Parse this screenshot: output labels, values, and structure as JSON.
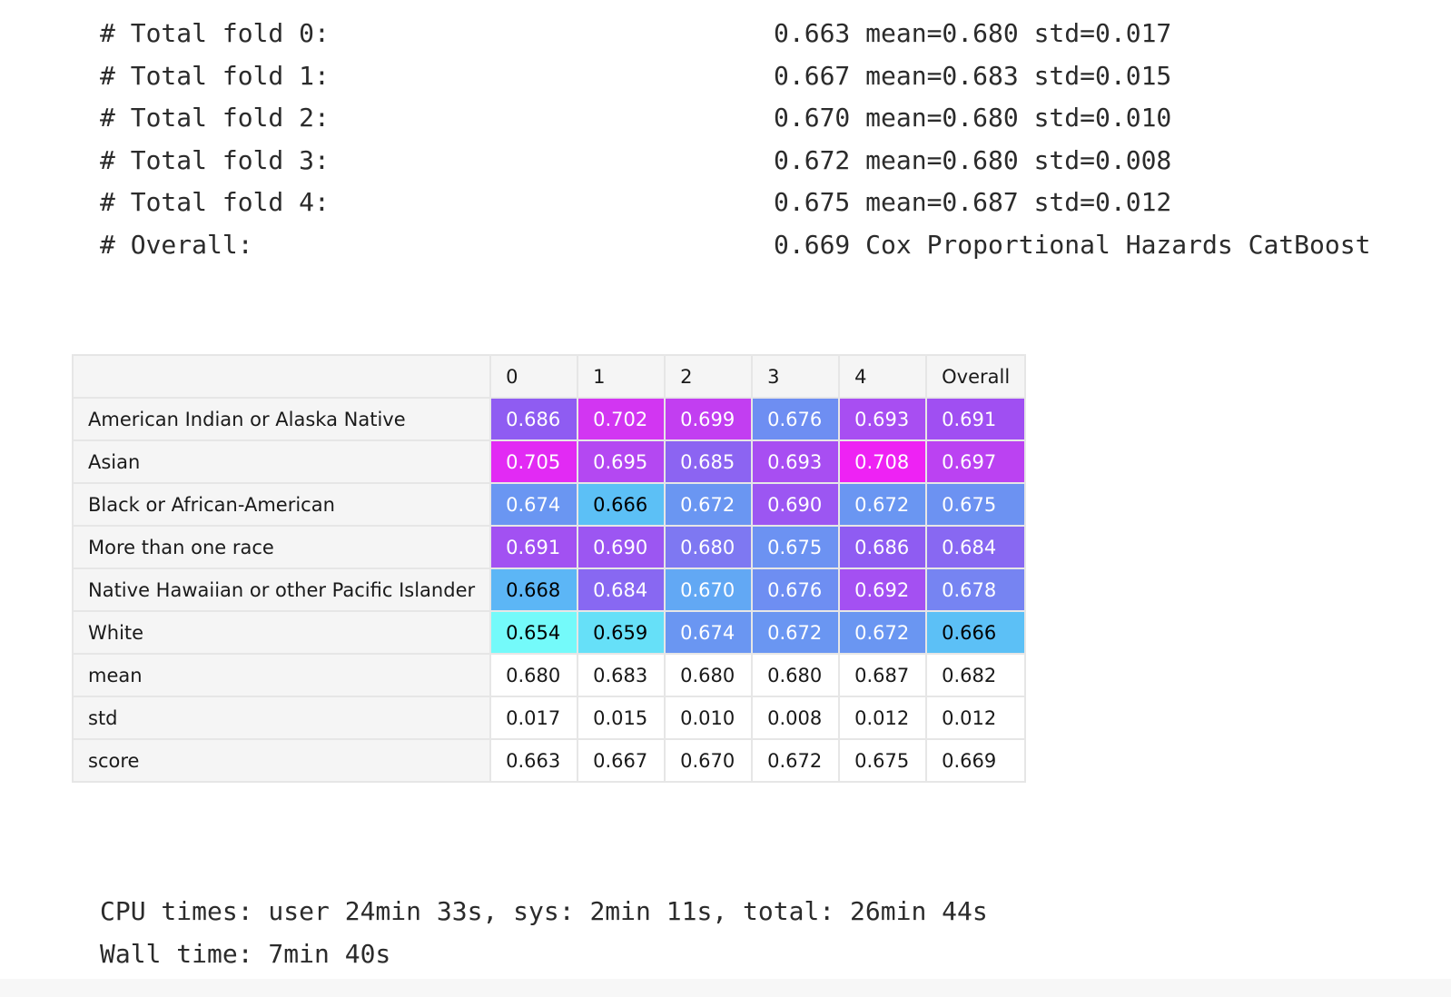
{
  "stdout_lines": [
    {
      "label": "# Total fold 0:",
      "value": "0.663 mean=0.680 std=0.017"
    },
    {
      "label": "# Total fold 1:",
      "value": "0.667 mean=0.683 std=0.015"
    },
    {
      "label": "# Total fold 2:",
      "value": "0.670 mean=0.680 std=0.010"
    },
    {
      "label": "# Total fold 3:",
      "value": "0.672 mean=0.680 std=0.008"
    },
    {
      "label": "# Total fold 4:",
      "value": "0.675 mean=0.687 std=0.012"
    },
    {
      "label": "# Overall:",
      "value": "0.669 Cox Proportional Hazards CatBoost"
    }
  ],
  "table": {
    "columns": [
      "0",
      "1",
      "2",
      "3",
      "4",
      "Overall"
    ],
    "rows": [
      {
        "label": "American Indian or Alaska Native",
        "cells": [
          {
            "v": "0.686",
            "bg": "#8f5cf2",
            "fg": "#ffffff"
          },
          {
            "v": "0.702",
            "bg": "#d236f2",
            "fg": "#ffffff"
          },
          {
            "v": "0.699",
            "bg": "#c23ef1",
            "fg": "#ffffff"
          },
          {
            "v": "0.676",
            "bg": "#6e8ef2",
            "fg": "#ffffff"
          },
          {
            "v": "0.693",
            "bg": "#a84ef2",
            "fg": "#ffffff"
          },
          {
            "v": "0.691",
            "bg": "#a04ff2",
            "fg": "#ffffff"
          }
        ]
      },
      {
        "label": "Asian",
        "cells": [
          {
            "v": "0.705",
            "bg": "#e22af4",
            "fg": "#ffffff"
          },
          {
            "v": "0.695",
            "bg": "#b448f2",
            "fg": "#ffffff"
          },
          {
            "v": "0.685",
            "bg": "#8c64f2",
            "fg": "#ffffff"
          },
          {
            "v": "0.693",
            "bg": "#a84ef2",
            "fg": "#ffffff"
          },
          {
            "v": "0.708",
            "bg": "#ee22f4",
            "fg": "#ffffff"
          },
          {
            "v": "0.697",
            "bg": "#bb42f2",
            "fg": "#ffffff"
          }
        ]
      },
      {
        "label": "Black or African-American",
        "cells": [
          {
            "v": "0.674",
            "bg": "#6a96f2",
            "fg": "#ffffff"
          },
          {
            "v": "0.666",
            "bg": "#5cc0f6",
            "fg": "#000000"
          },
          {
            "v": "0.672",
            "bg": "#6a96f2",
            "fg": "#ffffff"
          },
          {
            "v": "0.690",
            "bg": "#9c56f2",
            "fg": "#ffffff"
          },
          {
            "v": "0.672",
            "bg": "#6a96f2",
            "fg": "#ffffff"
          },
          {
            "v": "0.675",
            "bg": "#6c92f2",
            "fg": "#ffffff"
          }
        ]
      },
      {
        "label": "More than one race",
        "cells": [
          {
            "v": "0.691",
            "bg": "#a251f2",
            "fg": "#ffffff"
          },
          {
            "v": "0.690",
            "bg": "#9c56f2",
            "fg": "#ffffff"
          },
          {
            "v": "0.680",
            "bg": "#7e78f2",
            "fg": "#ffffff"
          },
          {
            "v": "0.675",
            "bg": "#6c92f2",
            "fg": "#ffffff"
          },
          {
            "v": "0.686",
            "bg": "#8f5cf2",
            "fg": "#ffffff"
          },
          {
            "v": "0.684",
            "bg": "#8868f2",
            "fg": "#ffffff"
          }
        ]
      },
      {
        "label": "Native Hawaiian or other Pacific Islander",
        "cells": [
          {
            "v": "0.668",
            "bg": "#5cb6f6",
            "fg": "#000000"
          },
          {
            "v": "0.684",
            "bg": "#8868f2",
            "fg": "#ffffff"
          },
          {
            "v": "0.670",
            "bg": "#62a8f4",
            "fg": "#ffffff"
          },
          {
            "v": "0.676",
            "bg": "#6e8ef2",
            "fg": "#ffffff"
          },
          {
            "v": "0.692",
            "bg": "#a450f2",
            "fg": "#ffffff"
          },
          {
            "v": "0.678",
            "bg": "#7684f2",
            "fg": "#ffffff"
          }
        ]
      },
      {
        "label": "White",
        "cells": [
          {
            "v": "0.654",
            "bg": "#74fafa",
            "fg": "#000000"
          },
          {
            "v": "0.659",
            "bg": "#66e0f8",
            "fg": "#000000"
          },
          {
            "v": "0.674",
            "bg": "#6a96f2",
            "fg": "#ffffff"
          },
          {
            "v": "0.672",
            "bg": "#6a96f2",
            "fg": "#ffffff"
          },
          {
            "v": "0.672",
            "bg": "#6a96f2",
            "fg": "#ffffff"
          },
          {
            "v": "0.666",
            "bg": "#5cc0f6",
            "fg": "#000000"
          }
        ]
      },
      {
        "label": "mean",
        "cells": [
          {
            "v": "0.680"
          },
          {
            "v": "0.683"
          },
          {
            "v": "0.680"
          },
          {
            "v": "0.680"
          },
          {
            "v": "0.687"
          },
          {
            "v": "0.682"
          }
        ]
      },
      {
        "label": "std",
        "cells": [
          {
            "v": "0.017"
          },
          {
            "v": "0.015"
          },
          {
            "v": "0.010"
          },
          {
            "v": "0.008"
          },
          {
            "v": "0.012"
          },
          {
            "v": "0.012"
          }
        ]
      },
      {
        "label": "score",
        "cells": [
          {
            "v": "0.663"
          },
          {
            "v": "0.667"
          },
          {
            "v": "0.670"
          },
          {
            "v": "0.672"
          },
          {
            "v": "0.675"
          },
          {
            "v": "0.669"
          }
        ]
      }
    ]
  },
  "cpu": {
    "times": "CPU times: user 24min 33s, sys: 2min 11s, total: 26min 44s",
    "wall": "Wall time: 7min 40s"
  }
}
